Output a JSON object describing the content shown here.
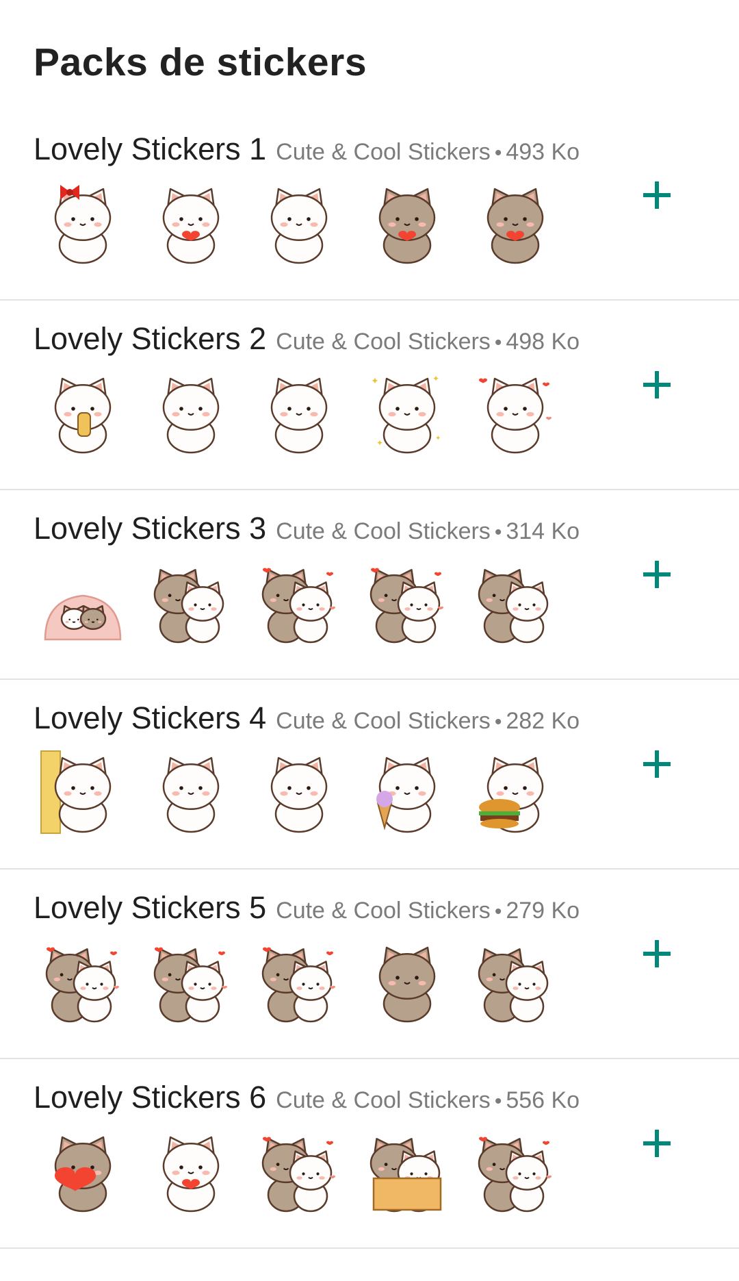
{
  "page_title": "Packs de stickers",
  "colors": {
    "accent": "#00897b",
    "cat_white": "#fffdfb",
    "cat_brown": "#b6a18d",
    "outline": "#5a3a2a",
    "heart": "#f24430"
  },
  "packs": [
    {
      "name": "Lovely Stickers 1",
      "publisher": "Cute & Cool Stickers",
      "separator": "•",
      "size": "493 Ko",
      "add_icon": "plus-icon",
      "stickers": [
        {
          "cat": "white",
          "extra": "bow"
        },
        {
          "cat": "white",
          "extra": "heart"
        },
        {
          "cat": "white",
          "extra": "none"
        },
        {
          "cat": "brown",
          "extra": "heart"
        },
        {
          "cat": "brown",
          "extra": "heart"
        }
      ]
    },
    {
      "name": "Lovely Stickers 2",
      "publisher": "Cute & Cool Stickers",
      "separator": "•",
      "size": "498 Ko",
      "add_icon": "plus-icon",
      "stickers": [
        {
          "cat": "white",
          "extra": "bottle"
        },
        {
          "cat": "white",
          "extra": "none"
        },
        {
          "cat": "white",
          "extra": "none"
        },
        {
          "cat": "white",
          "extra": "sparkles"
        },
        {
          "cat": "white",
          "extra": "hearts"
        }
      ]
    },
    {
      "name": "Lovely Stickers 3",
      "publisher": "Cute & Cool Stickers",
      "separator": "•",
      "size": "314 Ko",
      "add_icon": "plus-icon",
      "stickers": [
        {
          "cat": "pair",
          "extra": "blanket"
        },
        {
          "cat": "pair",
          "extra": "none"
        },
        {
          "cat": "pair",
          "extra": "hearts"
        },
        {
          "cat": "pair",
          "extra": "hearts"
        },
        {
          "cat": "pair",
          "extra": "none"
        }
      ]
    },
    {
      "name": "Lovely Stickers 4",
      "publisher": "Cute & Cool Stickers",
      "separator": "•",
      "size": "282 Ko",
      "add_icon": "plus-icon",
      "stickers": [
        {
          "cat": "white",
          "extra": "wall"
        },
        {
          "cat": "white",
          "extra": "none"
        },
        {
          "cat": "white",
          "extra": "none"
        },
        {
          "cat": "white",
          "extra": "icecream"
        },
        {
          "cat": "white",
          "extra": "burger"
        }
      ]
    },
    {
      "name": "Lovely Stickers 5",
      "publisher": "Cute & Cool Stickers",
      "separator": "•",
      "size": "279 Ko",
      "add_icon": "plus-icon",
      "stickers": [
        {
          "cat": "pair",
          "extra": "hearts"
        },
        {
          "cat": "pair",
          "extra": "hearts"
        },
        {
          "cat": "pair",
          "extra": "hearts"
        },
        {
          "cat": "brown",
          "extra": "none"
        },
        {
          "cat": "pair",
          "extra": "none"
        }
      ]
    },
    {
      "name": "Lovely Stickers 6",
      "publisher": "Cute & Cool Stickers",
      "separator": "•",
      "size": "556 Ko",
      "add_icon": "plus-icon",
      "stickers": [
        {
          "cat": "brown",
          "extra": "bigheart"
        },
        {
          "cat": "white",
          "extra": "heart"
        },
        {
          "cat": "pair",
          "extra": "hearts"
        },
        {
          "cat": "pair",
          "extra": "box"
        },
        {
          "cat": "pair",
          "extra": "hearts"
        }
      ]
    }
  ]
}
